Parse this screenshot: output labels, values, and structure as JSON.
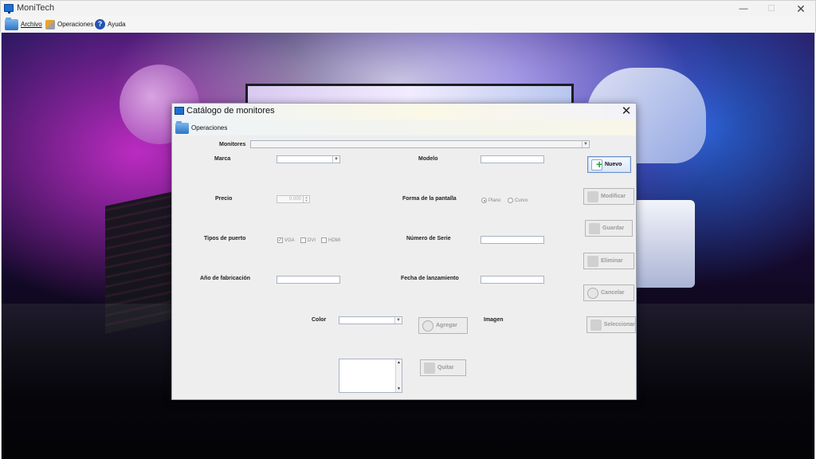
{
  "app": {
    "title": "MoniTech",
    "window_controls": {
      "minimize": "—",
      "maximize": "☐",
      "close": "✕"
    }
  },
  "menubar": {
    "items": [
      {
        "label": "Archivo",
        "icon": "folder-icon"
      },
      {
        "label": "Operaciones",
        "icon": "tools-icon"
      },
      {
        "label": "Ayuda",
        "icon": "help-icon"
      }
    ]
  },
  "dialog": {
    "title": "Catálogo de monitores",
    "close": "✕",
    "menu": {
      "label": "Operaciones",
      "icon": "folder-icon"
    },
    "labels": {
      "monitores": "Monitores",
      "marca": "Marca",
      "modelo": "Modelo",
      "precio": "Precio",
      "forma": "Forma de la pantalla",
      "tipos_puerto": "Tipos de puerto",
      "numero_serie": "Número de Serie",
      "anio": "Año de fabricación",
      "fecha": "Fecha de lanzamiento",
      "color": "Color",
      "imagen": "Imagen"
    },
    "precio_value": "0.000",
    "forma_options": [
      {
        "label": "Plano",
        "selected": true
      },
      {
        "label": "Curvo",
        "selected": false
      }
    ],
    "puertos": [
      {
        "label": "VGA",
        "checked": true
      },
      {
        "label": "DVI",
        "checked": false
      },
      {
        "label": "HDMI",
        "checked": false
      }
    ],
    "buttons": {
      "nuevo": "Nuevo",
      "modificar": "Modificar",
      "guardar": "Guardar",
      "eliminar": "Eliminar",
      "cancelar": "Cancelar",
      "seleccionar": "Seleccionar",
      "agregar": "Agregar",
      "quitar": "Quitar"
    }
  }
}
